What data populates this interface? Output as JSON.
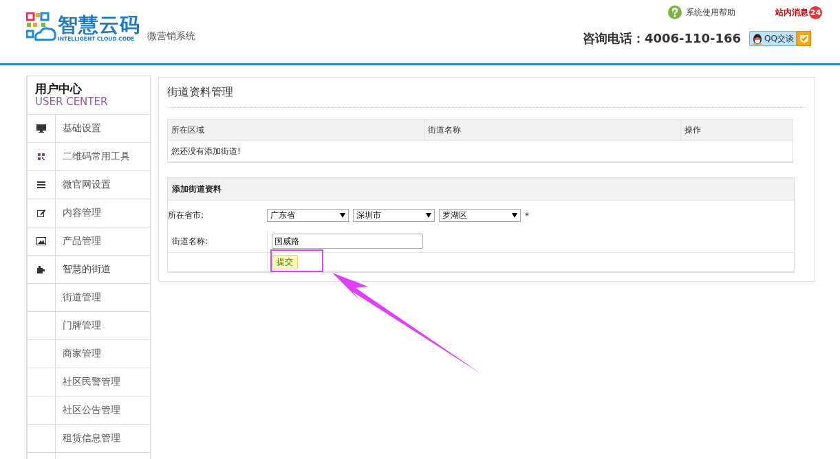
{
  "header": {
    "logo_title": "智慧云码",
    "logo_subtitle": "INTELLIGENT CLOUD CODE",
    "system_name": "微营销系统",
    "help_link": "系统使用帮助",
    "messages_link": "站内消息",
    "messages_count": "24",
    "phone": "咨询电话：4006-110-166",
    "qq_button": "QQ交谈"
  },
  "sidebar": {
    "title": "用户中心",
    "subtitle": "USER CENTER",
    "items": [
      {
        "label": "基础设置",
        "expanded": false
      },
      {
        "label": "二维码常用工具",
        "expanded": false
      },
      {
        "label": "微官网设置",
        "expanded": false
      },
      {
        "label": "内容管理",
        "expanded": false
      },
      {
        "label": "产品管理",
        "expanded": false
      },
      {
        "label": "智慧的街道",
        "expanded": true,
        "children": [
          {
            "label": "街道管理"
          },
          {
            "label": "门牌管理"
          },
          {
            "label": "商家管理"
          },
          {
            "label": "社区民警管理"
          },
          {
            "label": "社区公告管理"
          },
          {
            "label": "租赁信息管理"
          }
        ]
      }
    ]
  },
  "main": {
    "title": "街道资料管理",
    "table": {
      "columns": [
        "所在区域",
        "街道名称",
        "操作"
      ],
      "empty_message": "您还没有添加街道!"
    },
    "form": {
      "title": "添加街道资料",
      "region_label": "所在省市:",
      "province": "广东省",
      "city": "深圳市",
      "district": "罗湖区",
      "required_mark": "*",
      "street_label": "街道名称:",
      "street_value": "国威路",
      "submit": "提交"
    }
  }
}
